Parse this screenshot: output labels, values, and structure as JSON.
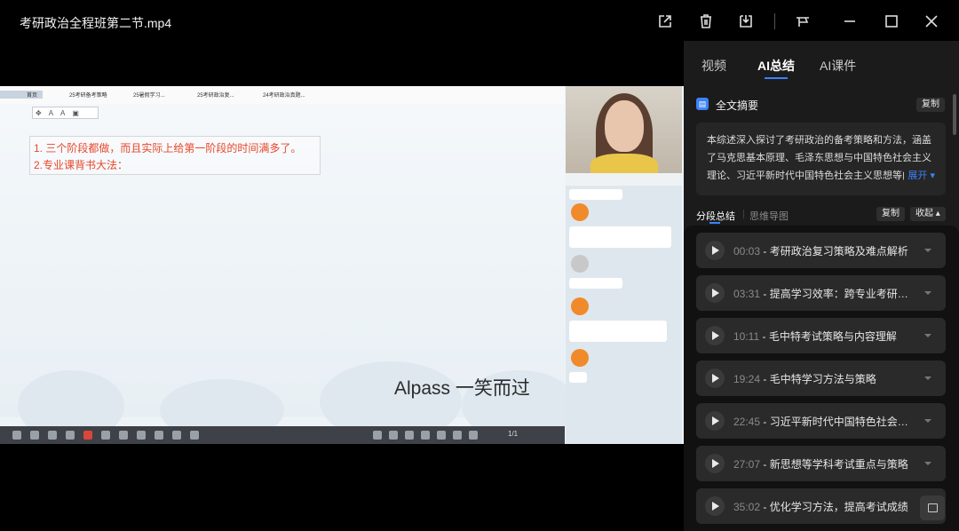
{
  "window": {
    "title": "考研政治全程班第二节.mp4"
  },
  "video": {
    "tabs": [
      "首页",
      "25考研备考策略",
      "25暑假学习...",
      "25考研政治复...",
      "24考研政治真题..."
    ],
    "slide_lines": [
      "1. 三个阶段都做，而且实际上给第一阶段的时间满多了。",
      "2.专业课背书大法："
    ],
    "watermark": "Alpass 一笑而过",
    "page_indicator": "1/1"
  },
  "panel": {
    "tabs": [
      "视频",
      "AI总结",
      "AI课件"
    ],
    "summary_title": "全文摘要",
    "copy_label": "复制",
    "summary_text": "本综述深入探讨了考研政治的备考策略和方法，涵盖了马克思基本原理、毛泽东思想与中国特色社会主义理论、习近平新时代中国特色社会主义思想等内容",
    "expand_label": "展开 ▾",
    "seg_tabs": [
      "分段总结",
      "思维导图"
    ],
    "seg_copy": "复制",
    "collapse": "收起 ▴",
    "items": [
      {
        "time": "00:03",
        "title": "- 考研政治复习策略及难点解析"
      },
      {
        "time": "03:31",
        "title": "- 提高学习效率：跨专业考研经验分享"
      },
      {
        "time": "10:11",
        "title": "- 毛中特考试策略与内容理解"
      },
      {
        "time": "19:24",
        "title": "- 毛中特学习方法与策略"
      },
      {
        "time": "22:45",
        "title": "- 习近平新时代中国特色社会主义思想"
      },
      {
        "time": "27:07",
        "title": "- 新思想等学科考试重点与策略"
      },
      {
        "time": "35:02",
        "title": "- 优化学习方法，提高考试成绩"
      }
    ]
  }
}
